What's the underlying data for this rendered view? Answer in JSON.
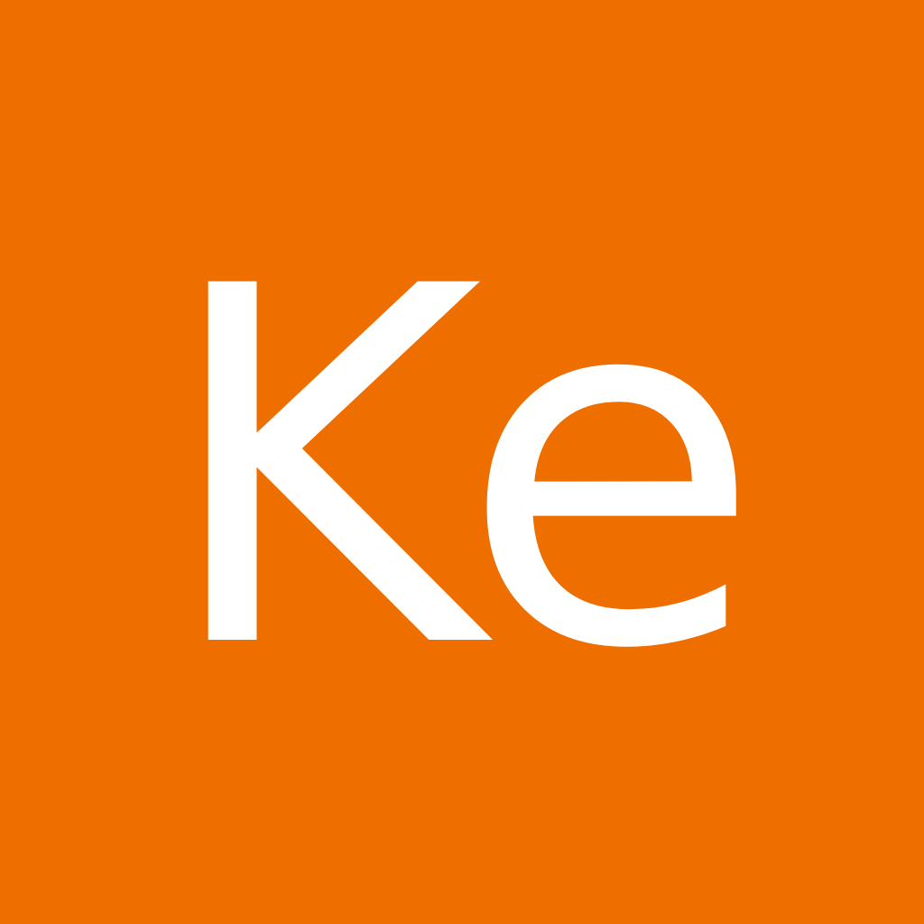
{
  "avatar": {
    "initials": "Ke",
    "background_color": "#EE6E00",
    "text_color": "#FFFFFF"
  }
}
